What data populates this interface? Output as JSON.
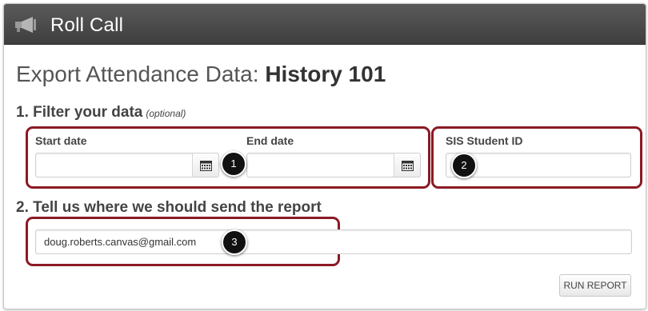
{
  "app": {
    "title": "Roll Call"
  },
  "page": {
    "title_prefix": "Export Attendance Data: ",
    "course_name": "History 101"
  },
  "filter_section": {
    "heading": "1. Filter your data",
    "optional_note": "(optional)",
    "start_date": {
      "label": "Start date",
      "value": ""
    },
    "end_date": {
      "label": "End date",
      "value": ""
    },
    "sis_student_id": {
      "label": "SIS Student ID",
      "value": ""
    }
  },
  "send_section": {
    "heading": "2. Tell us where we should send the report",
    "email": {
      "value": "doug.roberts.canvas@gmail.com"
    }
  },
  "actions": {
    "run_report": "RUN REPORT"
  },
  "callouts": [
    "1",
    "2",
    "3"
  ],
  "colors": {
    "highlight": "#8b1a24",
    "titlebar": "#4a4a4a"
  },
  "icons": {
    "app": "megaphone-icon",
    "date_picker": "calendar-icon"
  }
}
